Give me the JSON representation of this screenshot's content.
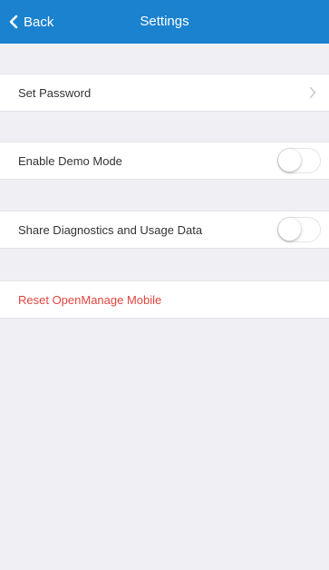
{
  "navbar": {
    "back_label": "Back",
    "title": "Settings",
    "back_icon": "chevron-left-icon"
  },
  "settings": {
    "set_password_label": "Set Password",
    "set_password_icon": "chevron-right-icon",
    "demo_mode_label": "Enable Demo Mode",
    "demo_mode_on": false,
    "diagnostics_label": "Share Diagnostics and Usage Data",
    "diagnostics_on": false,
    "reset_label": "Reset OpenManage Mobile"
  },
  "colors": {
    "navbar_bg": "#1a82cf",
    "background": "#efeff4",
    "danger": "#e0453e"
  }
}
